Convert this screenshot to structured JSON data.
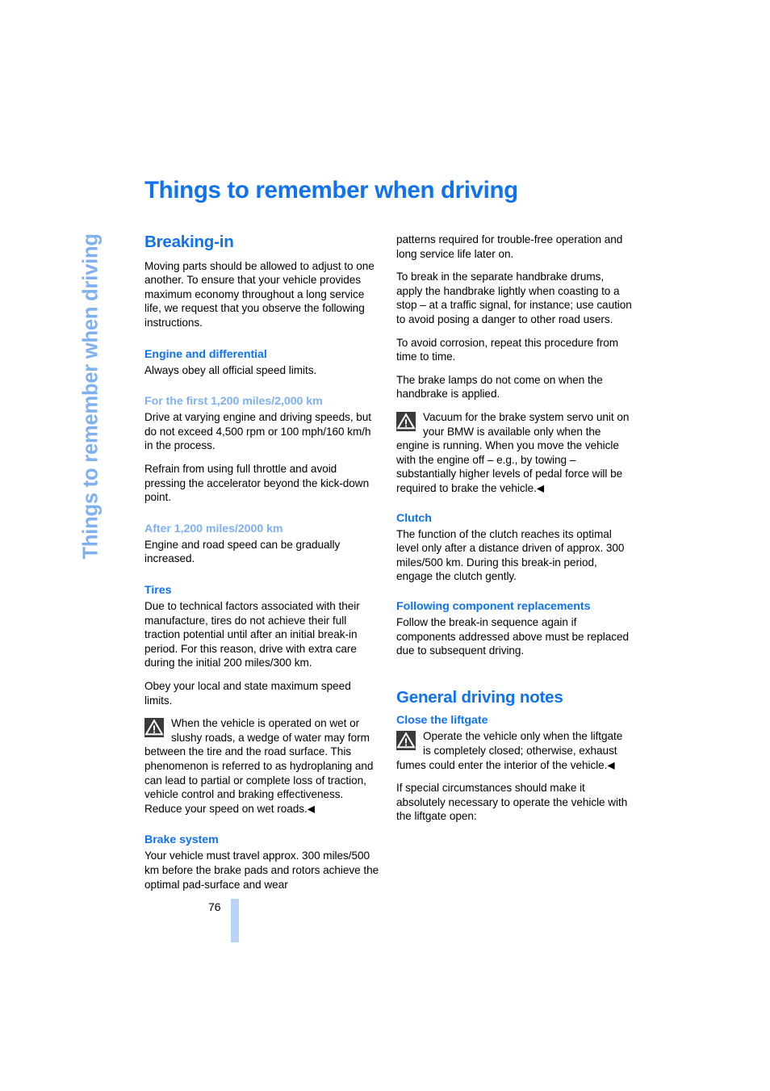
{
  "document": {
    "chapter_title": "Things to remember when driving",
    "running_head": "Things to remember when driving",
    "page_number": "76",
    "end_marker": "◀",
    "colors": {
      "heading_blue": "#0f72ee",
      "light_blue": "#7fb0ef",
      "tab_blue": "#b7d4f7",
      "warning_icon_bg": "#3a3a3a",
      "body_text": "#000000"
    }
  },
  "left_column": {
    "section_title": "Breaking-in",
    "intro": "Moving parts should be allowed to adjust to one another. To ensure that your vehicle provides maximum economy throughout a long service life, we request that you observe the following instructions.",
    "engine_heading": "Engine and differential",
    "engine_text": "Always obey all official speed limits.",
    "first_miles_heading": "For the first 1,200 miles/2,000 km",
    "first_miles_p1": "Drive at varying engine and driving speeds, but do not exceed 4,500 rpm or 100 mph/160 km/h in the process.",
    "first_miles_p2": "Refrain from using full throttle and avoid pressing the accelerator beyond the kick-down point.",
    "after_miles_heading": "After 1,200 miles/2000 km",
    "after_miles_text": "Engine and road speed can be gradually increased.",
    "tires_heading": "Tires",
    "tires_p1": "Due to technical factors associated with their manufacture, tires do not achieve their full traction potential until after an initial break-in period. For this reason, drive with extra care during the initial 200 miles/300 km.",
    "tires_p2": "Obey your local and state maximum speed limits.",
    "tires_warning": "When the vehicle is operated on wet or slushy roads, a wedge of water may form between the tire and the road surface. This phenomenon is referred to as hydroplaning and can lead to partial or complete loss of traction, vehicle control and braking effectiveness. Reduce your speed on wet roads.",
    "brake_heading": "Brake system",
    "brake_text": "Your vehicle must travel approx. 300 miles/500 km before the brake pads and rotors achieve the optimal pad-surface and wear"
  },
  "right_column": {
    "brake_continued": "patterns required for trouble-free operation and long service life later on.",
    "handbrake_p1": "To break in the separate handbrake drums, apply the handbrake lightly when coasting to a stop – at a traffic signal, for instance; use caution to avoid posing a danger to other road users.",
    "handbrake_p2": "To avoid corrosion, repeat this procedure from time to time.",
    "handbrake_p3": "The brake lamps do not come on when the handbrake is applied.",
    "vacuum_warning": "Vacuum for the brake system servo unit on your BMW is available only when the engine is running. When you move the vehicle with the engine off – e.g., by towing – substantially higher levels of pedal force will be required to brake the vehicle.",
    "clutch_heading": "Clutch",
    "clutch_text": "The function of the clutch reaches its optimal level only after a distance driven of approx. 300 miles/500 km. During this break-in period, engage the clutch gently.",
    "component_heading": "Following component replacements",
    "component_text": "Follow the break-in sequence again if components addressed above must be replaced due to subsequent driving.",
    "general_title": "General driving notes",
    "liftgate_heading": "Close the liftgate",
    "liftgate_warning": "Operate the vehicle only when the liftgate is completely closed; otherwise, exhaust fumes could enter the interior of the vehicle.",
    "liftgate_text": "If special circumstances should make it absolutely necessary to operate the vehicle with the liftgate open:"
  },
  "icons": {
    "warning": "warning-triangle-icon"
  }
}
